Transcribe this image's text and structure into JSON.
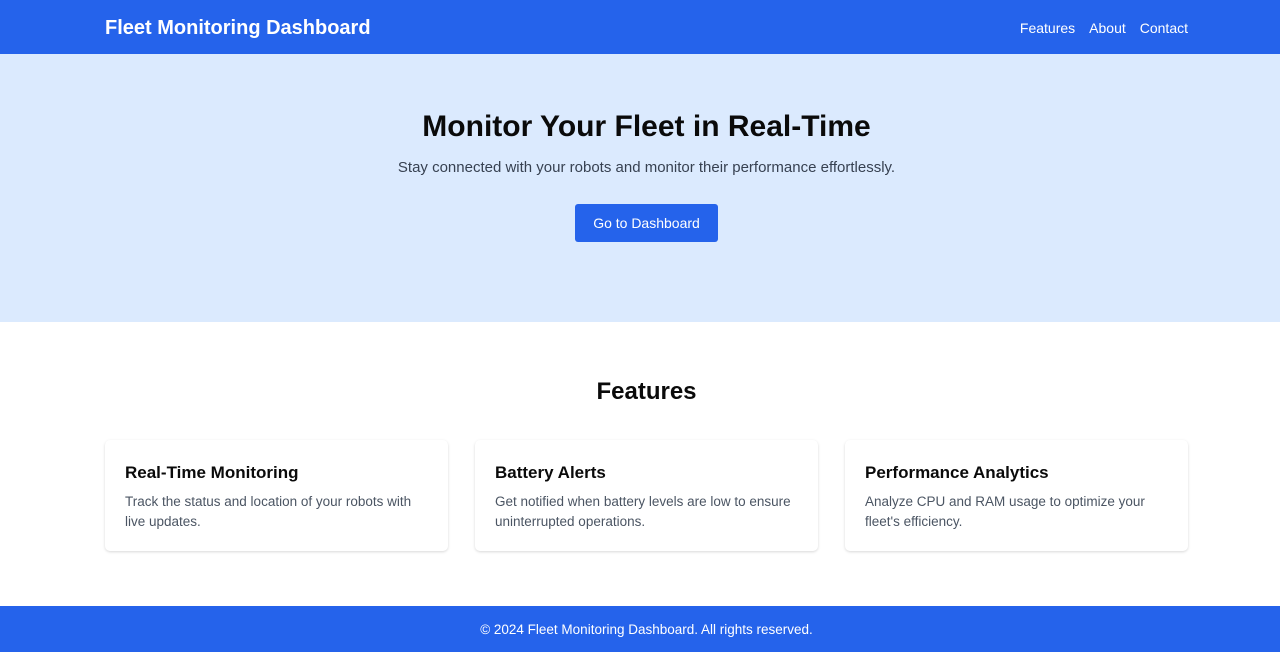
{
  "header": {
    "brand": "Fleet Monitoring Dashboard",
    "nav": [
      {
        "label": "Features"
      },
      {
        "label": "About"
      },
      {
        "label": "Contact"
      }
    ]
  },
  "hero": {
    "title": "Monitor Your Fleet in Real-Time",
    "subtitle": "Stay connected with your robots and monitor their performance effortlessly.",
    "cta_label": "Go to Dashboard"
  },
  "features": {
    "heading": "Features",
    "cards": [
      {
        "title": "Real-Time Monitoring",
        "description": "Track the status and location of your robots with live updates."
      },
      {
        "title": "Battery Alerts",
        "description": "Get notified when battery levels are low to ensure uninterrupted operations."
      },
      {
        "title": "Performance Analytics",
        "description": "Analyze CPU and RAM usage to optimize your fleet's efficiency."
      }
    ]
  },
  "footer": {
    "text": "© 2024 Fleet Monitoring Dashboard. All rights reserved."
  },
  "colors": {
    "primary": "#2563eb",
    "hero_background": "#dbeafe"
  }
}
